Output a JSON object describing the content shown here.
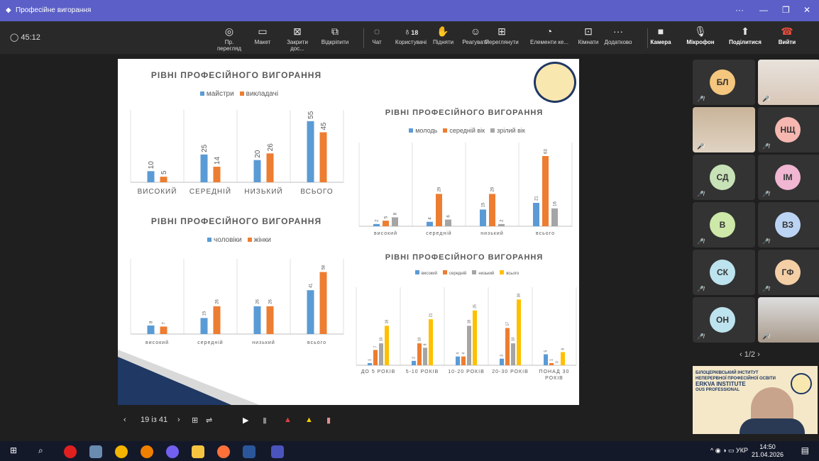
{
  "window": {
    "title": "Професійне вигорання"
  },
  "timer": "45:12",
  "toolbar": {
    "items": [
      {
        "label": "Пр. перегляд",
        "icon": "eye-icon"
      },
      {
        "label": "Макет",
        "icon": "layout-icon"
      },
      {
        "label": "Закрити дос...",
        "icon": "stop-share-icon"
      },
      {
        "label": "Відкріпити",
        "icon": "unpin-icon"
      },
      {
        "label": "Чат",
        "icon": "chat-icon"
      },
      {
        "label": "Користувачі",
        "icon": "people-icon",
        "count": "18"
      },
      {
        "label": "Підняти",
        "icon": "raise-hand-icon"
      },
      {
        "label": "Реагувати",
        "icon": "smile-icon"
      },
      {
        "label": "Переглянути",
        "icon": "grid-icon"
      },
      {
        "label": "Елементи ке...",
        "icon": "apps-icon"
      },
      {
        "label": "Кімнати",
        "icon": "rooms-icon"
      },
      {
        "label": "Додатково",
        "icon": "more-icon"
      }
    ],
    "camera": "Камера",
    "mic": "Мікрофон",
    "share": "Поділитися",
    "leave": "Вийти"
  },
  "slide_controls": {
    "page": "19 із 41"
  },
  "charts": [
    {
      "title": "РІВНІ ПРОФЕСІЙНОГО ВИГОРАННЯ",
      "legend": [
        "майстри",
        "викладачі"
      ],
      "colors": [
        "#5b9bd5",
        "#ed7d31"
      ],
      "categories": [
        "ВИСОКИЙ",
        "СЕРЕДНІЙ",
        "НИЗЬКИЙ",
        "ВСЬОГО"
      ],
      "series": [
        [
          10,
          25,
          20,
          55
        ],
        [
          5,
          14,
          26,
          45
        ]
      ],
      "ymax": 60
    },
    {
      "title": "РІВНІ ПРОФЕСІЙНОГО ВИГОРАННЯ",
      "legend": [
        "чоловіки",
        "жінки"
      ],
      "colors": [
        "#5b9bd5",
        "#ed7d31"
      ],
      "categories": [
        "високий",
        "середній",
        "низький",
        "всього"
      ],
      "series": [
        [
          8,
          15,
          26,
          41
        ],
        [
          7,
          26,
          26,
          58
        ]
      ],
      "ymax": 65
    },
    {
      "title": "РІВНІ ПРОФЕСІЙНОГО ВИГОРАННЯ",
      "legend": [
        "молодь",
        "середній вік",
        "зрілий вік"
      ],
      "colors": [
        "#5b9bd5",
        "#ed7d31",
        "#a5a5a5"
      ],
      "categories": [
        "високий",
        "середній",
        "низький",
        "всього"
      ],
      "series": [
        [
          2,
          4,
          15,
          21
        ],
        [
          5,
          29,
          29,
          63
        ],
        [
          8,
          6,
          2,
          16
        ]
      ],
      "ymax": 70
    },
    {
      "title": "РІВНІ ПРОФЕСІЙНОГО ВИГОРАННЯ",
      "legend": [
        "високий",
        "середній",
        "низький",
        "всього"
      ],
      "colors": [
        "#5b9bd5",
        "#ed7d31",
        "#a5a5a5",
        "#ffc000"
      ],
      "categories": [
        "ДО 5 РОКІВ",
        "5-10 РОКІВ",
        "10-20 РОКІВ",
        "20-30 РОКІВ",
        "ПОНАД 30 РОКІВ"
      ],
      "series": [
        [
          1,
          2,
          4,
          3,
          5
        ],
        [
          7,
          10,
          4,
          17,
          1
        ],
        [
          10,
          8,
          18,
          10,
          0
        ],
        [
          18,
          21,
          25,
          30,
          6
        ]
      ],
      "ymax": 33
    }
  ],
  "chart_data": [
    {
      "type": "bar",
      "title": "РІВНІ ПРОФЕСІЙНОГО ВИГОРАННЯ",
      "categories": [
        "ВИСОКИЙ",
        "СЕРЕДНІЙ",
        "НИЗЬКИЙ",
        "ВСЬОГО"
      ],
      "series": [
        {
          "name": "майстри",
          "values": [
            10,
            25,
            20,
            55
          ]
        },
        {
          "name": "викладачі",
          "values": [
            5,
            14,
            26,
            45
          ]
        }
      ]
    },
    {
      "type": "bar",
      "title": "РІВНІ ПРОФЕСІЙНОГО ВИГОРАННЯ",
      "categories": [
        "високий",
        "середній",
        "низький",
        "всього"
      ],
      "series": [
        {
          "name": "чоловіки",
          "values": [
            8,
            15,
            26,
            41
          ]
        },
        {
          "name": "жінки",
          "values": [
            7,
            26,
            26,
            58
          ]
        }
      ]
    },
    {
      "type": "bar",
      "title": "РІВНІ ПРОФЕСІЙНОГО ВИГОРАННЯ",
      "categories": [
        "високий",
        "середній",
        "низький",
        "всього"
      ],
      "series": [
        {
          "name": "молодь",
          "values": [
            2,
            4,
            15,
            21
          ]
        },
        {
          "name": "середній вік",
          "values": [
            5,
            29,
            29,
            63
          ]
        },
        {
          "name": "зрілий вік",
          "values": [
            8,
            6,
            2,
            16
          ]
        }
      ]
    },
    {
      "type": "bar",
      "title": "РІВНІ ПРОФЕСІЙНОГО ВИГОРАННЯ",
      "categories": [
        "ДО 5 РОКІВ",
        "5-10 РОКІВ",
        "10-20 РОКІВ",
        "20-30 РОКІВ",
        "ПОНАД 30 РОКІВ"
      ],
      "series": [
        {
          "name": "високий",
          "values": [
            1,
            2,
            4,
            3,
            5
          ]
        },
        {
          "name": "середній",
          "values": [
            7,
            10,
            4,
            17,
            1
          ]
        },
        {
          "name": "низький",
          "values": [
            10,
            8,
            18,
            10,
            0
          ]
        },
        {
          "name": "всього",
          "values": [
            18,
            21,
            25,
            30,
            6
          ]
        }
      ]
    }
  ],
  "participants": [
    {
      "initials": "БЛ",
      "color": "#f5c77e",
      "muted": true
    },
    {
      "initials": "",
      "photo": true,
      "muted": true
    },
    {
      "initials": "",
      "photo": true,
      "muted": true
    },
    {
      "initials": "НЩ",
      "color": "#f6b7b1",
      "muted": true
    },
    {
      "initials": "СД",
      "color": "#c8e2b8",
      "muted": true
    },
    {
      "initials": "ІМ",
      "color": "#f0b6d2",
      "muted": true
    },
    {
      "initials": "В",
      "color": "#cde8a8",
      "muted": true
    },
    {
      "initials": "ВЗ",
      "color": "#bcd4f4",
      "muted": true
    },
    {
      "initials": "СК",
      "color": "#bde3ee",
      "muted": true
    },
    {
      "initials": "ГФ",
      "color": "#f4cfa6",
      "muted": true
    },
    {
      "initials": "ОН",
      "color": "#bde3ee",
      "muted": true
    },
    {
      "initials": "",
      "photo": true,
      "muted": true
    }
  ],
  "pager": "1/2",
  "presenter": {
    "banner1": "БІЛОЦЕРКІВСЬКИЙ ІНСТИТУТ",
    "banner2": "НЕПЕРЕРВНОЇ ПРОФЕСІЙНОЇ ОСВІТИ",
    "banner3": "ERKVA INSTITUTE",
    "banner4": "OUS PROFESSIONAL"
  },
  "taskbar": {
    "lang": "УКР",
    "time": "14:50",
    "date": "21.04.2026"
  }
}
